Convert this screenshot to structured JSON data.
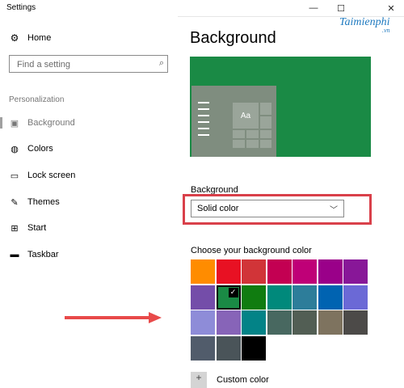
{
  "window": {
    "title": "Settings",
    "controls": {
      "minimize": "—",
      "maximize": "☐",
      "close": "✕"
    }
  },
  "watermark": {
    "text": "Taimienphi",
    "sub": ".vn"
  },
  "sidebar": {
    "home": {
      "label": "Home",
      "icon": "gear-icon"
    },
    "search": {
      "placeholder": "Find a setting",
      "value": ""
    },
    "section": "Personalization",
    "items": [
      {
        "label": "Background",
        "icon": "picture-icon",
        "active": true
      },
      {
        "label": "Colors",
        "icon": "palette-icon",
        "active": false
      },
      {
        "label": "Lock screen",
        "icon": "lock-screen-icon",
        "active": false
      },
      {
        "label": "Themes",
        "icon": "brush-icon",
        "active": false
      },
      {
        "label": "Start",
        "icon": "start-icon",
        "active": false
      },
      {
        "label": "Taskbar",
        "icon": "taskbar-icon",
        "active": false
      }
    ]
  },
  "main": {
    "title": "Background",
    "preview": {
      "sample_text": "Aa",
      "background_color": "#1a8a45"
    },
    "background_label": "Background",
    "background_select": {
      "selected": "Solid color"
    },
    "choose_label": "Choose your background color",
    "swatches": [
      [
        "#ff8c00",
        "#e81123",
        "#d13438",
        "#c30052",
        "#bf0077",
        "#9a0089",
        "#881798"
      ],
      [
        "#744da9",
        "#1a8a45",
        "#107c10",
        "#00897b",
        "#2d7d9a",
        "#0063b1",
        "#6b69d6"
      ],
      [
        "#8e8cd8",
        "#8764b8",
        "#038387",
        "#486860",
        "#525e54",
        "#7e735f",
        "#4c4a48"
      ],
      [
        "#515c6b",
        "#4a5459",
        "#000000"
      ]
    ],
    "selected_swatch": {
      "row": 1,
      "col": 1,
      "check": "✓"
    },
    "custom_color": {
      "label": "Custom color",
      "icon_text": "+"
    }
  },
  "annotation": {
    "arrow_color": "#e84a4a",
    "highlight_color": "#d9404a"
  }
}
